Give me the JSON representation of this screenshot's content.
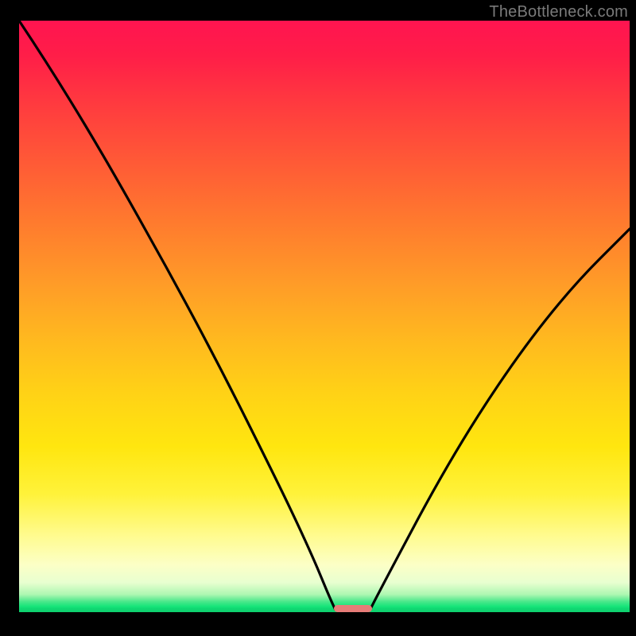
{
  "watermark": "TheBottleneck.com",
  "colors": {
    "frame": "#000000",
    "curve": "#000000",
    "marker": "#e77c78",
    "gradient_top": "#ff1450",
    "gradient_bottom": "#0fd06e"
  },
  "chart_data": {
    "type": "line",
    "title": "",
    "xlabel": "",
    "ylabel": "",
    "xlim": [
      0,
      100
    ],
    "ylim": [
      0,
      100
    ],
    "note": "Axes are unlabeled in the source image; x and y are normalized 0–100 left→right and bottom→top. Values are read off pixel positions.",
    "series": [
      {
        "name": "left-branch",
        "x": [
          0.0,
          3.0,
          7.0,
          12.0,
          18.0,
          24.0,
          30.0,
          35.0,
          40.0,
          44.0,
          47.0,
          49.5,
          51.0
        ],
        "y": [
          100.0,
          92.0,
          82.0,
          70.0,
          57.0,
          45.0,
          34.0,
          25.0,
          17.0,
          10.0,
          5.0,
          1.5,
          0.3
        ]
      },
      {
        "name": "right-branch",
        "x": [
          57.0,
          59.0,
          62.0,
          66.0,
          71.0,
          77.0,
          83.0,
          89.0,
          95.0,
          100.0
        ],
        "y": [
          0.5,
          3.0,
          8.0,
          15.0,
          24.0,
          34.0,
          44.0,
          53.0,
          61.0,
          67.0
        ]
      }
    ],
    "marker": {
      "name": "bottleneck-indicator",
      "shape": "pill",
      "x_center": 54.0,
      "width_x": 6.0,
      "y": 0.4
    },
    "gradient_scale": {
      "description": "Background vertical gradient encodes magnitude: red (high) at top through orange/yellow to green (low) at bottom.",
      "stops_pct_from_top": [
        0,
        24,
        54,
        80,
        92,
        100
      ],
      "stop_colors": [
        "#ff1450",
        "#ff5a36",
        "#ffd216",
        "#fff23a",
        "#e8ffd0",
        "#0fd06e"
      ]
    }
  }
}
